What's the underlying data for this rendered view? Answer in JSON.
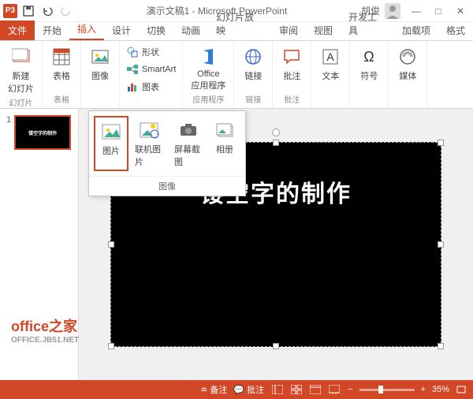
{
  "titlebar": {
    "app_badge": "P3",
    "title": "演示文稿1 - Microsoft PowerPoint",
    "user": "胡俊"
  },
  "tabs": {
    "file": "文件",
    "items": [
      "开始",
      "插入",
      "设计",
      "切换",
      "动画",
      "幻灯片放映",
      "审阅",
      "视图",
      "开发工具",
      "加载项",
      "格式"
    ],
    "active_index": 1
  },
  "ribbon": {
    "groups": {
      "slides": {
        "label": "幻灯片",
        "new_slide": "新建\n幻灯片"
      },
      "tables": {
        "label": "表格",
        "table": "表格"
      },
      "images": {
        "label": "图像",
        "image": "图像"
      },
      "illus": {
        "shapes": "形状",
        "smartart": "SmartArt",
        "chart": "图表"
      },
      "apps": {
        "label": "应用程序",
        "office": "Office\n应用程序"
      },
      "links": {
        "label": "链接",
        "link": "链接"
      },
      "comments": {
        "label": "批注",
        "comment": "批注"
      },
      "text": {
        "text": "文本"
      },
      "symbols": {
        "symbol": "符号"
      },
      "media": {
        "media": "媒体"
      }
    }
  },
  "dropdown": {
    "picture": "图片",
    "online_picture": "联机图片",
    "screenshot": "屏幕截图",
    "album": "相册",
    "footer": "图像"
  },
  "thumbs": {
    "num": "1",
    "text": "镂空字的制作"
  },
  "slide": {
    "text": "镂空字的制作"
  },
  "watermark": {
    "main": "office之家",
    "sub": "OFFICE.JB51.NET"
  },
  "statusbar": {
    "notes": "备注",
    "comments": "批注",
    "zoom": "35%"
  }
}
